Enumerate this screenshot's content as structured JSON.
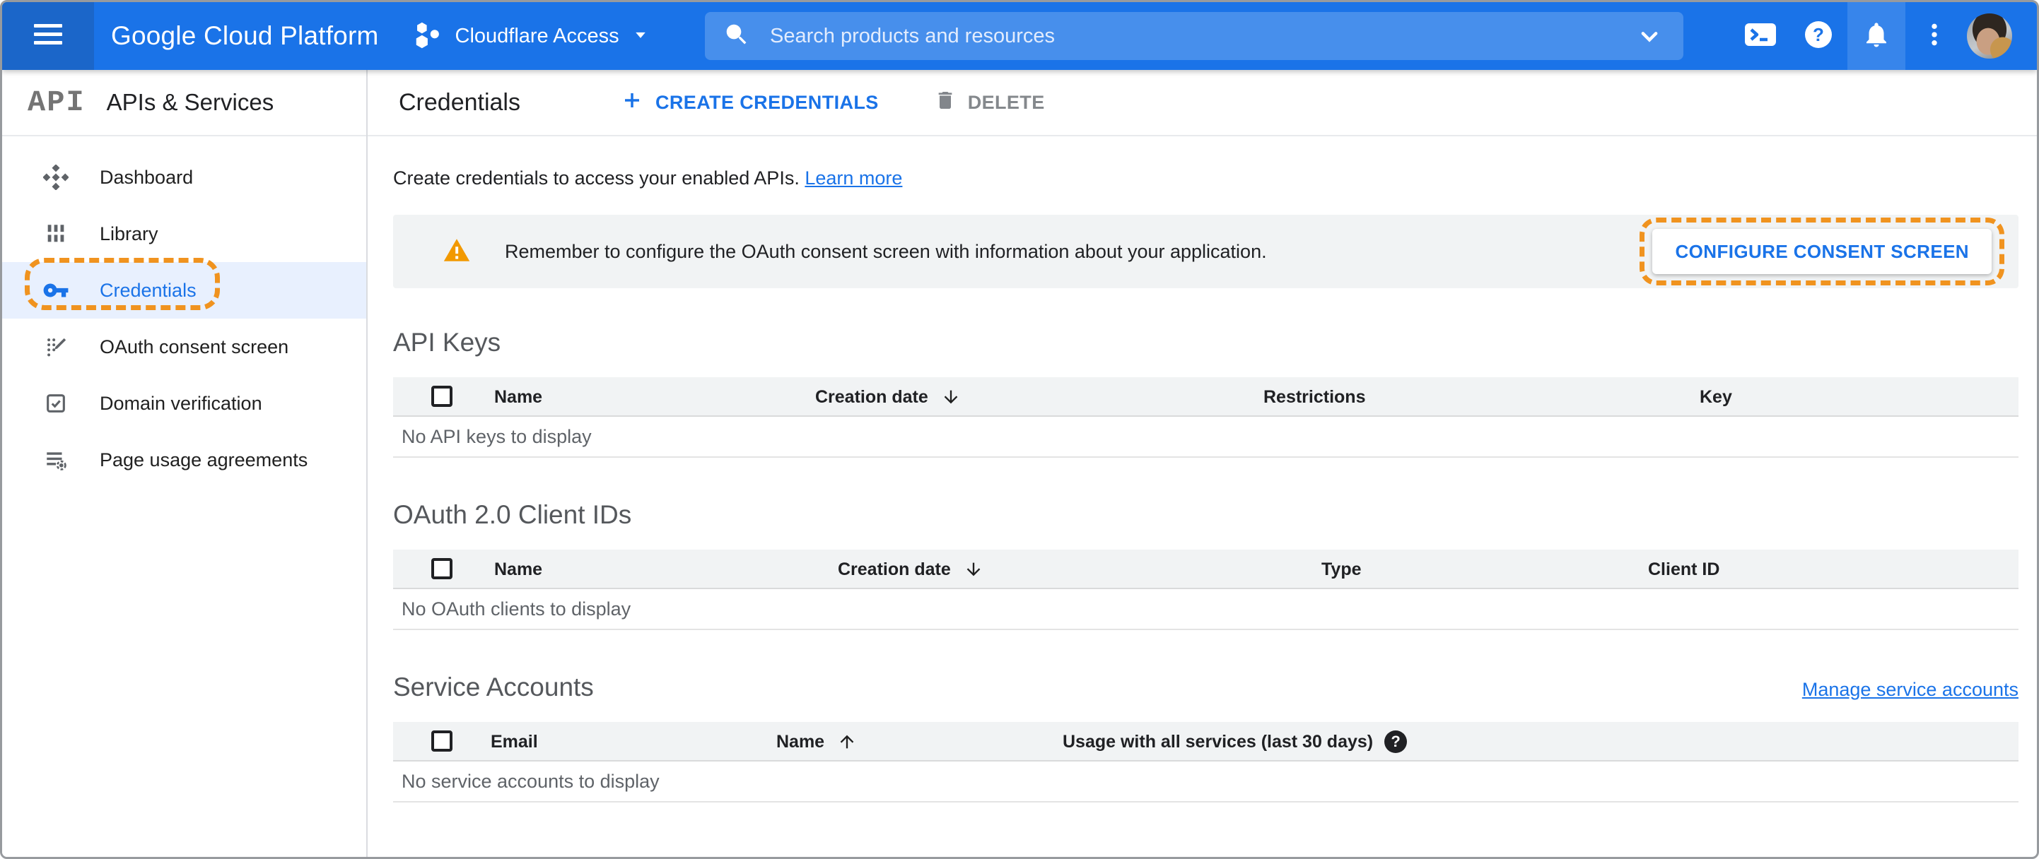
{
  "topbar": {
    "logo": "Google Cloud Platform",
    "project": "Cloudflare Access",
    "search_placeholder": "Search products and resources"
  },
  "sidebar": {
    "logo": "API",
    "title": "APIs & Services",
    "items": [
      {
        "label": "Dashboard"
      },
      {
        "label": "Library"
      },
      {
        "label": "Credentials",
        "active": true,
        "annotated": true
      },
      {
        "label": "OAuth consent screen"
      },
      {
        "label": "Domain verification"
      },
      {
        "label": "Page usage agreements"
      }
    ]
  },
  "toolbar": {
    "title": "Credentials",
    "create_label": "CREATE CREDENTIALS",
    "delete_label": "DELETE"
  },
  "intro": {
    "text": "Create credentials to access your enabled APIs.",
    "link_label": "Learn more"
  },
  "banner": {
    "message": "Remember to configure the OAuth consent screen with information about your application.",
    "button_label": "CONFIGURE CONSENT SCREEN"
  },
  "api_keys": {
    "title": "API Keys",
    "columns": {
      "name": "Name",
      "creation_date": "Creation date",
      "restrictions": "Restrictions",
      "key": "Key"
    },
    "sort": "Creation date, descending",
    "empty_text": "No API keys to display"
  },
  "oauth_clients": {
    "title": "OAuth 2.0 Client IDs",
    "columns": {
      "name": "Name",
      "creation_date": "Creation date",
      "type": "Type",
      "client_id": "Client ID"
    },
    "sort": "Creation date, descending",
    "empty_text": "No OAuth clients to display"
  },
  "service_accounts": {
    "title": "Service Accounts",
    "manage_link_label": "Manage service accounts",
    "columns": {
      "email": "Email",
      "name": "Name",
      "usage": "Usage with all services (last 30 days)"
    },
    "sort": "Name, ascending",
    "help_glyph": "?",
    "empty_text": "No service accounts to display"
  },
  "colors": {
    "topbar_blue": "#1a73e8",
    "accent_blue": "#1a73e8",
    "active_item_bg": "#e8f0fe",
    "annotation_orange": "#f0931f",
    "warning_orange": "#f29900",
    "table_header_bg": "#f1f3f4",
    "banner_bg": "#f1f3f4"
  }
}
